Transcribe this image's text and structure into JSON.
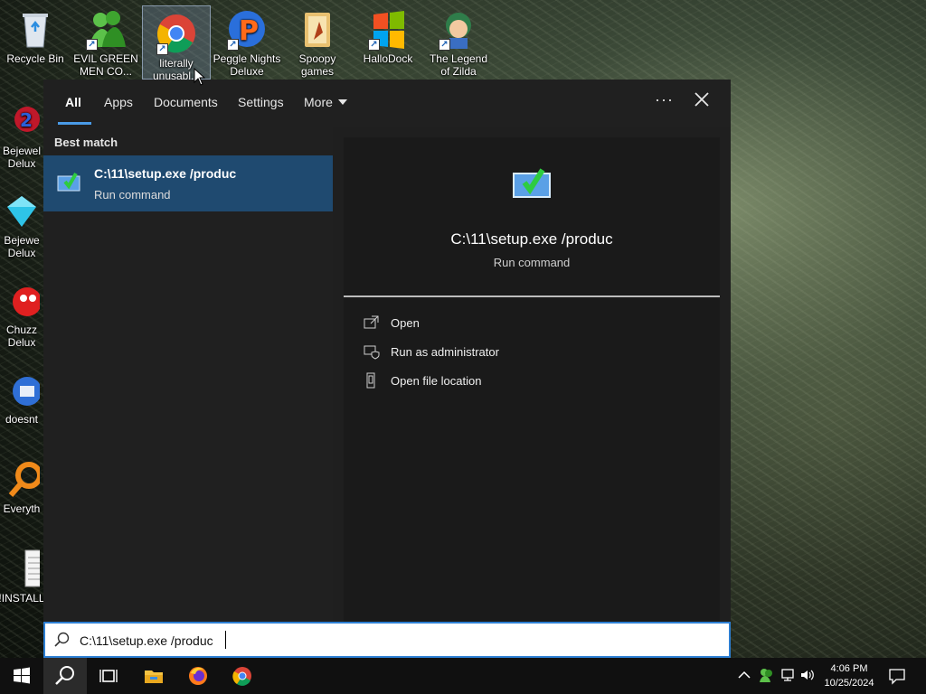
{
  "desktop": {
    "top_icons": [
      {
        "label": "Recycle Bin"
      },
      {
        "label": "EVIL GREEN MEN CO..."
      },
      {
        "label": "literally unusabl..."
      },
      {
        "label": "Peggle Nights Deluxe"
      },
      {
        "label": "Spoopy games"
      },
      {
        "label": "HalloDock"
      },
      {
        "label": "The Legend of Zilda"
      }
    ],
    "left_icons": [
      {
        "label": "Bejewel Delux"
      },
      {
        "label": "Bejewe Delux"
      },
      {
        "label": "Chuzz Delux"
      },
      {
        "label": "doesnt"
      },
      {
        "label": "Everyth"
      },
      {
        "label": "!INSTALL"
      }
    ]
  },
  "search_panel": {
    "tabs": [
      {
        "label": "All",
        "active": true
      },
      {
        "label": "Apps"
      },
      {
        "label": "Documents"
      },
      {
        "label": "Settings"
      },
      {
        "label": "More"
      }
    ],
    "options_glyph": "···",
    "section_label": "Best match",
    "best_match": {
      "title": "C:\\11\\setup.exe /produc",
      "subtitle": "Run command"
    },
    "detail": {
      "title": "C:\\11\\setup.exe /produc",
      "subtitle": "Run command",
      "actions": [
        {
          "label": "Open",
          "icon": "open-icon"
        },
        {
          "label": "Run as administrator",
          "icon": "shield-admin-icon"
        },
        {
          "label": "Open file location",
          "icon": "file-location-icon"
        }
      ]
    },
    "search_query": "C:\\11\\setup.exe /produc"
  },
  "taskbar": {
    "clock_time": "4:06 PM",
    "clock_date": "10/25/2024",
    "colors": {
      "accent": "#2d7fd3",
      "selection": "#1f4a70"
    }
  }
}
